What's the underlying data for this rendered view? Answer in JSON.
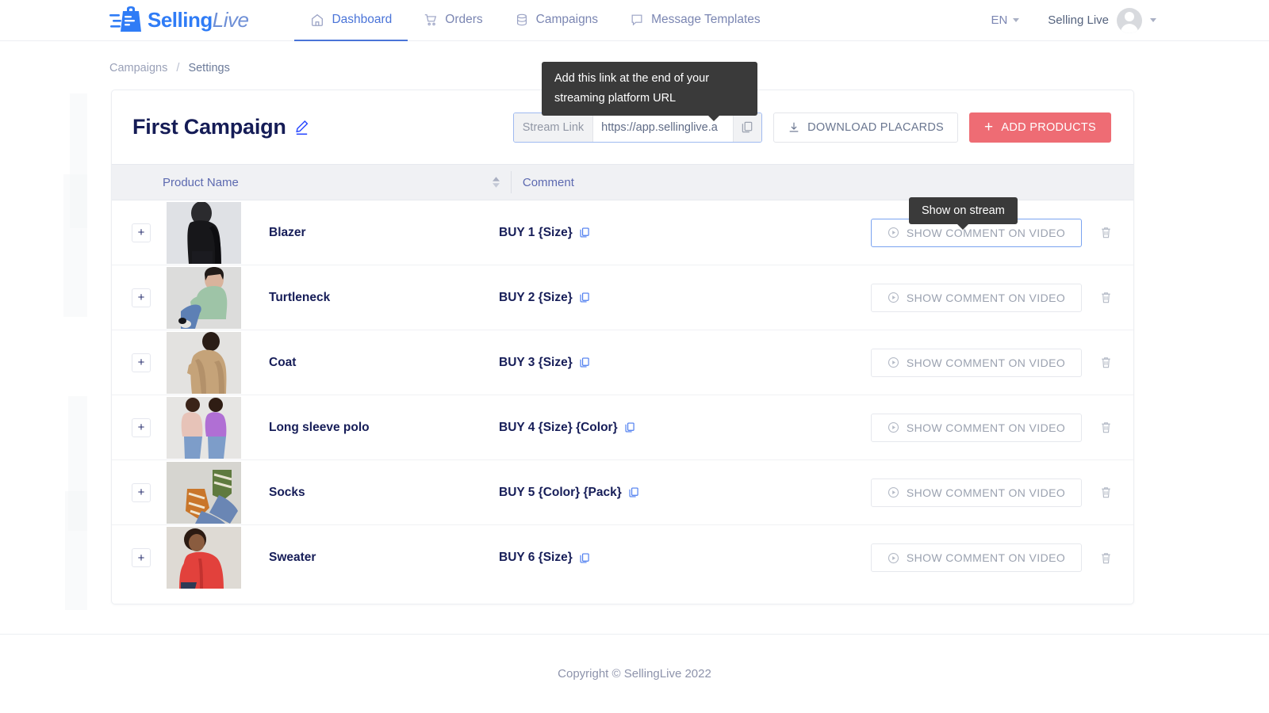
{
  "brand": {
    "name_bold": "Selling",
    "name_light": "Live"
  },
  "nav": {
    "items": [
      {
        "label": "Dashboard",
        "icon": "home-icon",
        "active": true
      },
      {
        "label": "Orders",
        "icon": "cart-icon",
        "active": false
      },
      {
        "label": "Campaigns",
        "icon": "database-icon",
        "active": false
      },
      {
        "label": "Message Templates",
        "icon": "chat-icon",
        "active": false
      }
    ]
  },
  "header_right": {
    "language": "EN",
    "user_name": "Selling Live"
  },
  "breadcrumb": {
    "parent": "Campaigns",
    "separator": "/",
    "current": "Settings"
  },
  "campaign": {
    "title": "First Campaign",
    "edit_icon": "pencil-icon"
  },
  "stream_link": {
    "label": "Stream Link",
    "value": "https://app.sellinglive.a",
    "placeholder": "https://app.sellinglive.a",
    "copy_icon": "copy-icon"
  },
  "actions": {
    "download_placards": "DOWNLOAD PLACARDS",
    "add_products": "ADD PRODUCTS",
    "add_products_color": "#ee6c74",
    "plus": "+"
  },
  "tooltips": {
    "stream_link": "Add this link at the end of your streaming platform URL",
    "show_on_stream": "Show on stream"
  },
  "table": {
    "columns": [
      "Product Name",
      "Comment"
    ],
    "show_button_label": "SHOW COMMENT ON VIDEO",
    "rows": [
      {
        "name": "Blazer",
        "comment": "BUY 1 {Size}",
        "focused": true
      },
      {
        "name": "Turtleneck",
        "comment": "BUY 2 {Size}",
        "focused": false
      },
      {
        "name": "Coat",
        "comment": "BUY 3 {Size}",
        "focused": false
      },
      {
        "name": "Long sleeve polo",
        "comment": "BUY 4 {Size} {Color}",
        "focused": false
      },
      {
        "name": "Socks",
        "comment": "BUY 5 {Color} {Pack}",
        "focused": false
      },
      {
        "name": "Sweater",
        "comment": "BUY 6 {Size}",
        "focused": false
      }
    ]
  },
  "footer": {
    "copyright": "Copyright © SellingLive 2022"
  }
}
